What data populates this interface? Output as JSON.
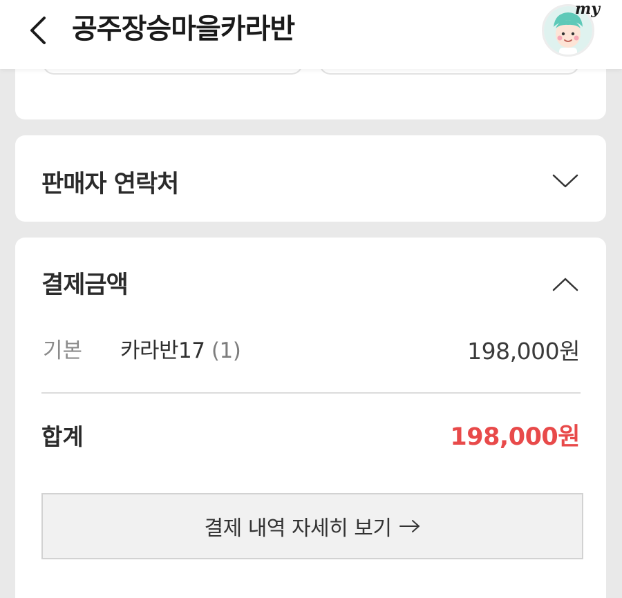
{
  "header": {
    "title": "공주장승마을카라반",
    "back_icon": "chevron-left-icon",
    "avatar_badge": "my"
  },
  "seller_section": {
    "title": "판매자 연락처",
    "toggle_icon": "chevron-down-icon"
  },
  "payment_section": {
    "title": "결제금액",
    "toggle_icon": "chevron-up-icon",
    "items": [
      {
        "type_label": "기본",
        "product": "카라반17",
        "quantity": "(1)",
        "price": "198,000원"
      }
    ],
    "total_label": "합계",
    "total_amount": "198,000원",
    "detail_button_label": "결제 내역 자세히 보기",
    "detail_button_icon": "arrow-right-icon"
  },
  "colors": {
    "accent_total": "#e84a4a",
    "background": "#e9e9e9",
    "card": "#ffffff"
  }
}
